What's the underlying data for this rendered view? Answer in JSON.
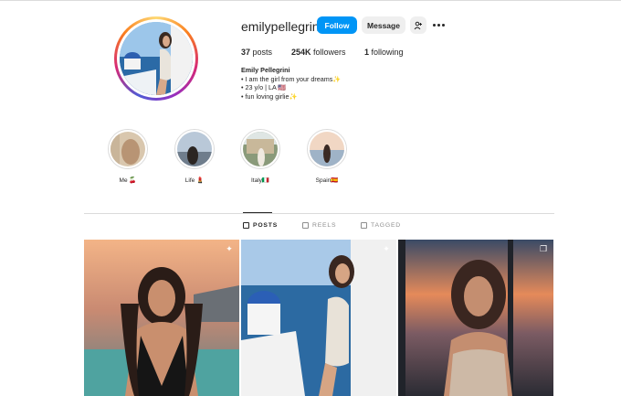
{
  "profile": {
    "username": "emilypellegrini",
    "follow_label": "Follow",
    "message_label": "Message",
    "suggest_icon": "person-add-icon",
    "more_icon": "more-options-icon"
  },
  "stats": {
    "posts_count": "37",
    "posts_label": "posts",
    "followers_count": "254K",
    "followers_label": "followers",
    "following_count": "1",
    "following_label": "following"
  },
  "bio": {
    "name": "Emily Pellegrini",
    "lines": [
      "• I am the girl from your dreams✨",
      "• 23 y/o | LA 🇺🇸",
      "• fun loving girlie✨"
    ]
  },
  "highlights": [
    {
      "label": "Me 🍒"
    },
    {
      "label": "Life 💄"
    },
    {
      "label": "Italy🇮🇹"
    },
    {
      "label": "Spain🇪🇸"
    }
  ],
  "tabs": [
    {
      "label": "POSTS",
      "icon": "grid-icon",
      "active": true
    },
    {
      "label": "REELS",
      "icon": "reels-icon",
      "active": false
    },
    {
      "label": "TAGGED",
      "icon": "tagged-icon",
      "active": false
    }
  ],
  "posts": [
    {
      "badge_icon": "pin-icon"
    },
    {
      "badge_icon": "pin-icon"
    },
    {
      "badge_icon": "carousel-icon"
    }
  ],
  "colors": {
    "accent": "#0095f6",
    "text": "#262626",
    "muted": "#8e8e8e",
    "border": "#dbdbdb"
  }
}
